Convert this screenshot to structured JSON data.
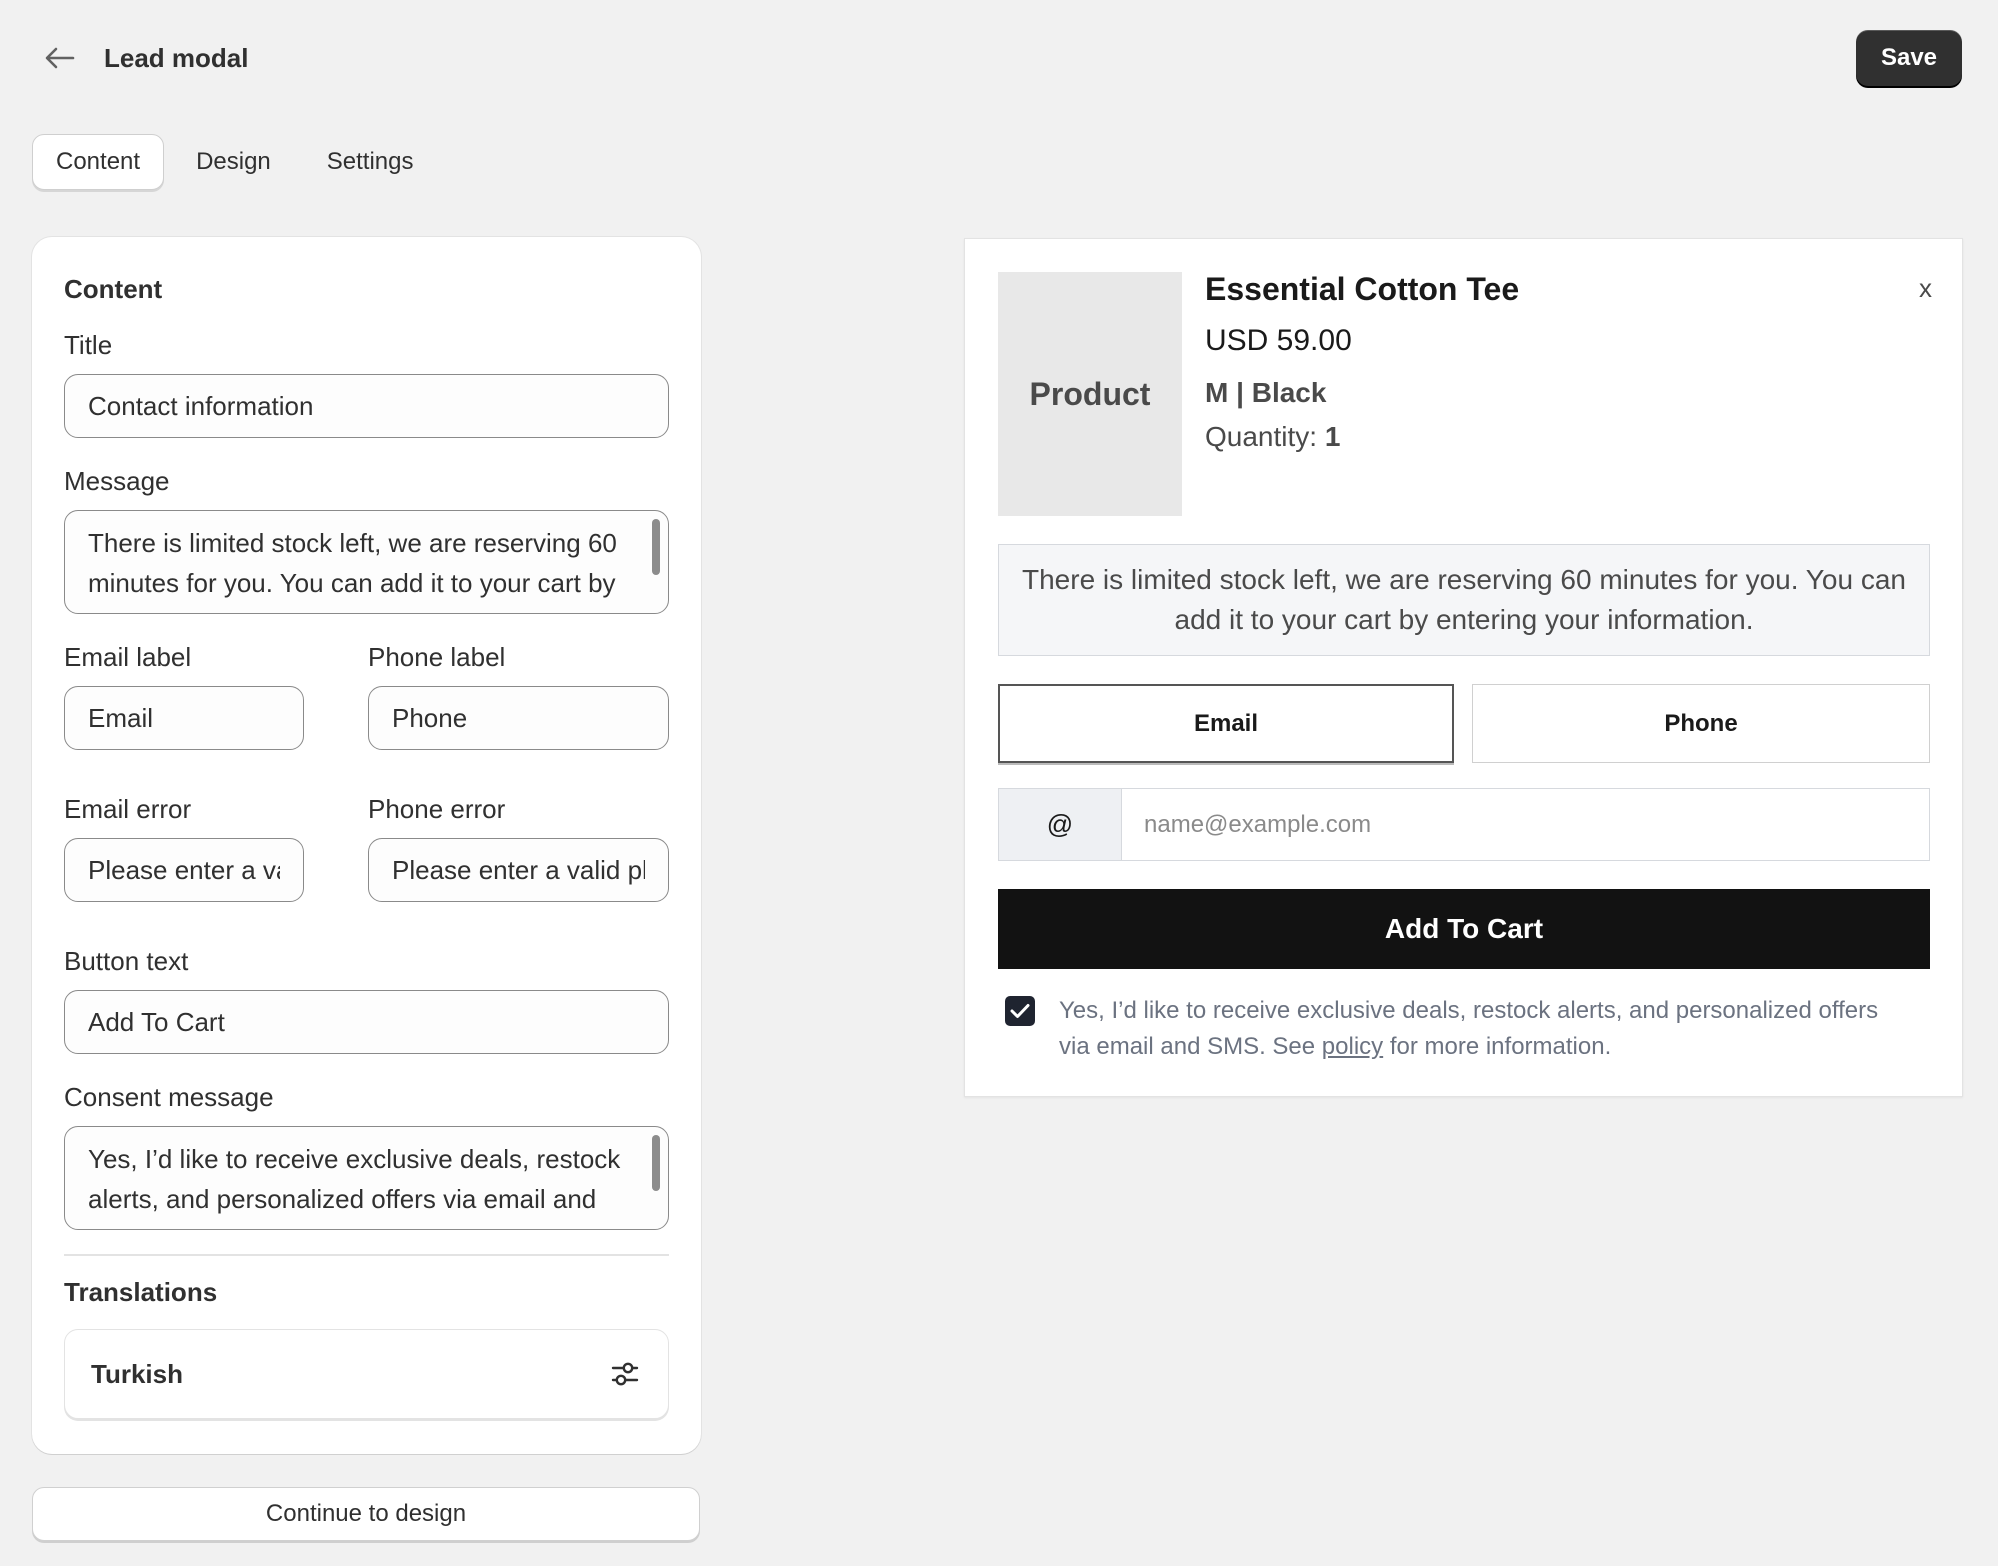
{
  "header": {
    "title": "Lead modal",
    "save_label": "Save"
  },
  "tabs": [
    {
      "label": "Content",
      "active": true
    },
    {
      "label": "Design",
      "active": false
    },
    {
      "label": "Settings",
      "active": false
    }
  ],
  "editor": {
    "section_title": "Content",
    "title_label": "Title",
    "title_value": "Contact information",
    "message_label": "Message",
    "message_value": "There is limited stock left, we are reserving 60 minutes for you. You can add it to your cart by entering your information.",
    "email_label_label": "Email label",
    "email_label_value": "Email",
    "phone_label_label": "Phone label",
    "phone_label_value": "Phone",
    "email_error_label": "Email error",
    "email_error_value": "Please enter a valid email",
    "phone_error_label": "Phone error",
    "phone_error_value": "Please enter a valid phone number",
    "button_text_label": "Button text",
    "button_text_value": "Add To Cart",
    "consent_label": "Consent message",
    "consent_value": "Yes, I’d like to receive exclusive deals, restock alerts, and personalized offers via email and SMS. See {policy} for more information.",
    "translations_title": "Translations",
    "translation_language": "Turkish",
    "continue_label": "Continue to design"
  },
  "preview": {
    "product_placeholder": "Product",
    "product_name": "Essential Cotton Tee",
    "price": "USD 59.00",
    "variant": "M | Black",
    "quantity_label": "Quantity:",
    "quantity_value": "1",
    "close_label": "x",
    "message": "There is limited stock left, we are reserving 60 minutes for you. You can add it to your cart by entering your information.",
    "email_tab": "Email",
    "phone_tab": "Phone",
    "at_symbol": "@",
    "email_placeholder": "name@example.com",
    "cta": "Add To Cart",
    "consent_before": "Yes, I’d like to receive exclusive deals, restock alerts, and personalized offers via email and SMS. See ",
    "consent_link": "policy",
    "consent_after": " for more information.",
    "consent_checked": true
  },
  "icons": {
    "back": "arrow-left-icon",
    "translation_settings": "sliders-icon",
    "check": "checkmark-icon"
  }
}
